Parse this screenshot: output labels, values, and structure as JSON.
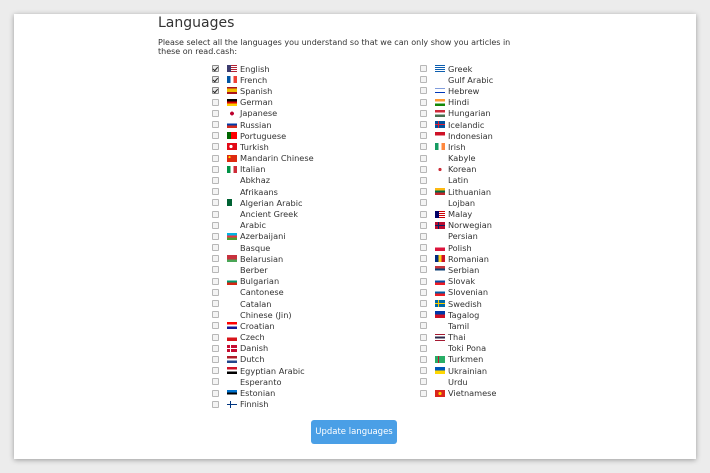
{
  "page": {
    "title": "Languages",
    "description": "Please select all the languages you understand so that we can only show you articles in these on read.cash:",
    "button_label": "Update languages"
  },
  "languages_left": [
    {
      "name": "English",
      "checked": true,
      "flag": "us"
    },
    {
      "name": "French",
      "checked": true,
      "flag": "fr"
    },
    {
      "name": "Spanish",
      "checked": true,
      "flag": "es"
    },
    {
      "name": "German",
      "checked": false,
      "flag": "de"
    },
    {
      "name": "Japanese",
      "checked": false,
      "flag": "jp"
    },
    {
      "name": "Russian",
      "checked": false,
      "flag": "ru"
    },
    {
      "name": "Portuguese",
      "checked": false,
      "flag": "pt"
    },
    {
      "name": "Turkish",
      "checked": false,
      "flag": "tr"
    },
    {
      "name": "Mandarin Chinese",
      "checked": false,
      "flag": "cn"
    },
    {
      "name": "Italian",
      "checked": false,
      "flag": "it"
    },
    {
      "name": "Abkhaz",
      "checked": false,
      "flag": ""
    },
    {
      "name": "Afrikaans",
      "checked": false,
      "flag": ""
    },
    {
      "name": "Algerian Arabic",
      "checked": false,
      "flag": "dz"
    },
    {
      "name": "Ancient Greek",
      "checked": false,
      "flag": ""
    },
    {
      "name": "Arabic",
      "checked": false,
      "flag": ""
    },
    {
      "name": "Azerbaijani",
      "checked": false,
      "flag": "az"
    },
    {
      "name": "Basque",
      "checked": false,
      "flag": ""
    },
    {
      "name": "Belarusian",
      "checked": false,
      "flag": "by"
    },
    {
      "name": "Berber",
      "checked": false,
      "flag": ""
    },
    {
      "name": "Bulgarian",
      "checked": false,
      "flag": "bg"
    },
    {
      "name": "Cantonese",
      "checked": false,
      "flag": ""
    },
    {
      "name": "Catalan",
      "checked": false,
      "flag": ""
    },
    {
      "name": "Chinese (Jin)",
      "checked": false,
      "flag": ""
    },
    {
      "name": "Croatian",
      "checked": false,
      "flag": "hr"
    },
    {
      "name": "Czech",
      "checked": false,
      "flag": "cz"
    },
    {
      "name": "Danish",
      "checked": false,
      "flag": "dk"
    },
    {
      "name": "Dutch",
      "checked": false,
      "flag": "nl"
    },
    {
      "name": "Egyptian Arabic",
      "checked": false,
      "flag": "eg"
    },
    {
      "name": "Esperanto",
      "checked": false,
      "flag": ""
    },
    {
      "name": "Estonian",
      "checked": false,
      "flag": "ee"
    },
    {
      "name": "Finnish",
      "checked": false,
      "flag": "fi"
    }
  ],
  "languages_right": [
    {
      "name": "Greek",
      "checked": false,
      "flag": "gr"
    },
    {
      "name": "Gulf Arabic",
      "checked": false,
      "flag": ""
    },
    {
      "name": "Hebrew",
      "checked": false,
      "flag": "il"
    },
    {
      "name": "Hindi",
      "checked": false,
      "flag": "in"
    },
    {
      "name": "Hungarian",
      "checked": false,
      "flag": "hu"
    },
    {
      "name": "Icelandic",
      "checked": false,
      "flag": "is"
    },
    {
      "name": "Indonesian",
      "checked": false,
      "flag": "id"
    },
    {
      "name": "Irish",
      "checked": false,
      "flag": "ie"
    },
    {
      "name": "Kabyle",
      "checked": false,
      "flag": ""
    },
    {
      "name": "Korean",
      "checked": false,
      "flag": "kr"
    },
    {
      "name": "Latin",
      "checked": false,
      "flag": ""
    },
    {
      "name": "Lithuanian",
      "checked": false,
      "flag": "lt"
    },
    {
      "name": "Lojban",
      "checked": false,
      "flag": ""
    },
    {
      "name": "Malay",
      "checked": false,
      "flag": "my"
    },
    {
      "name": "Norwegian",
      "checked": false,
      "flag": "no"
    },
    {
      "name": "Persian",
      "checked": false,
      "flag": ""
    },
    {
      "name": "Polish",
      "checked": false,
      "flag": "pl"
    },
    {
      "name": "Romanian",
      "checked": false,
      "flag": "ro"
    },
    {
      "name": "Serbian",
      "checked": false,
      "flag": "rs"
    },
    {
      "name": "Slovak",
      "checked": false,
      "flag": "sk"
    },
    {
      "name": "Slovenian",
      "checked": false,
      "flag": "si"
    },
    {
      "name": "Swedish",
      "checked": false,
      "flag": "se"
    },
    {
      "name": "Tagalog",
      "checked": false,
      "flag": "ph"
    },
    {
      "name": "Tamil",
      "checked": false,
      "flag": ""
    },
    {
      "name": "Thai",
      "checked": false,
      "flag": "th"
    },
    {
      "name": "Toki Pona",
      "checked": false,
      "flag": ""
    },
    {
      "name": "Turkmen",
      "checked": false,
      "flag": "tm"
    },
    {
      "name": "Ukrainian",
      "checked": false,
      "flag": "ua"
    },
    {
      "name": "Urdu",
      "checked": false,
      "flag": ""
    },
    {
      "name": "Vietnamese",
      "checked": false,
      "flag": "vn"
    }
  ],
  "colors": {
    "button": "#4a9fe6",
    "button_text": "#ffffff",
    "background": "#ececec",
    "card": "#ffffff"
  }
}
